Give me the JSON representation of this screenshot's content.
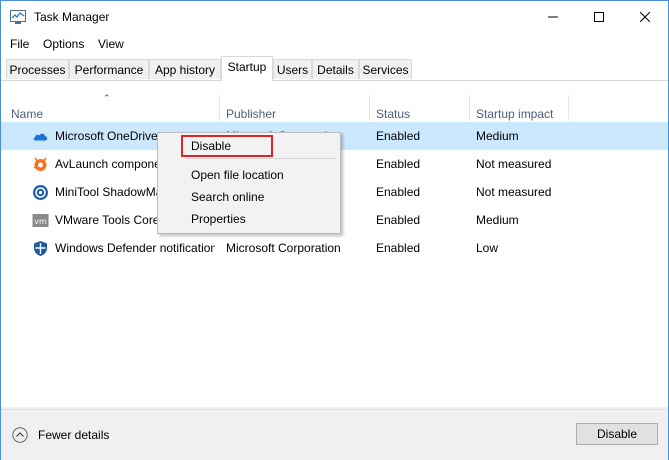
{
  "window": {
    "title": "Task Manager"
  },
  "menu": [
    "File",
    "Options",
    "View"
  ],
  "tabs": [
    "Processes",
    "Performance",
    "App history",
    "Startup",
    "Users",
    "Details",
    "Services"
  ],
  "active_tab": "Startup",
  "columns": {
    "name": "Name",
    "publisher": "Publisher",
    "status": "Status",
    "impact": "Startup impact"
  },
  "rows": [
    {
      "name": "Microsoft OneDrive",
      "publisher": "Microsoft Corporation",
      "status": "Enabled",
      "impact": "Medium",
      "icon": "onedrive-icon",
      "selected": true
    },
    {
      "name": "AvLaunch component",
      "publisher": "",
      "status": "Enabled",
      "impact": "Not measured",
      "icon": "avast-icon"
    },
    {
      "name": "MiniTool ShadowMaker",
      "publisher": "",
      "status": "Enabled",
      "impact": "Not measured",
      "icon": "minitool-icon"
    },
    {
      "name": "VMware Tools Core",
      "publisher": "",
      "status": "Enabled",
      "impact": "Medium",
      "icon": "vmware-icon"
    },
    {
      "name": "Windows Defender notification icon",
      "publisher": "Microsoft Corporation",
      "status": "Enabled",
      "impact": "Low",
      "icon": "windows-defender-icon"
    }
  ],
  "context_menu": {
    "disable": "Disable",
    "open_file_location": "Open file location",
    "search_online": "Search online",
    "properties": "Properties"
  },
  "footer": {
    "fewer_details": "Fewer details",
    "disable_button": "Disable"
  },
  "colors": {
    "selected_row": "#cce8ff",
    "highlight": "#e0242d",
    "window_border": "#4a90d9"
  }
}
